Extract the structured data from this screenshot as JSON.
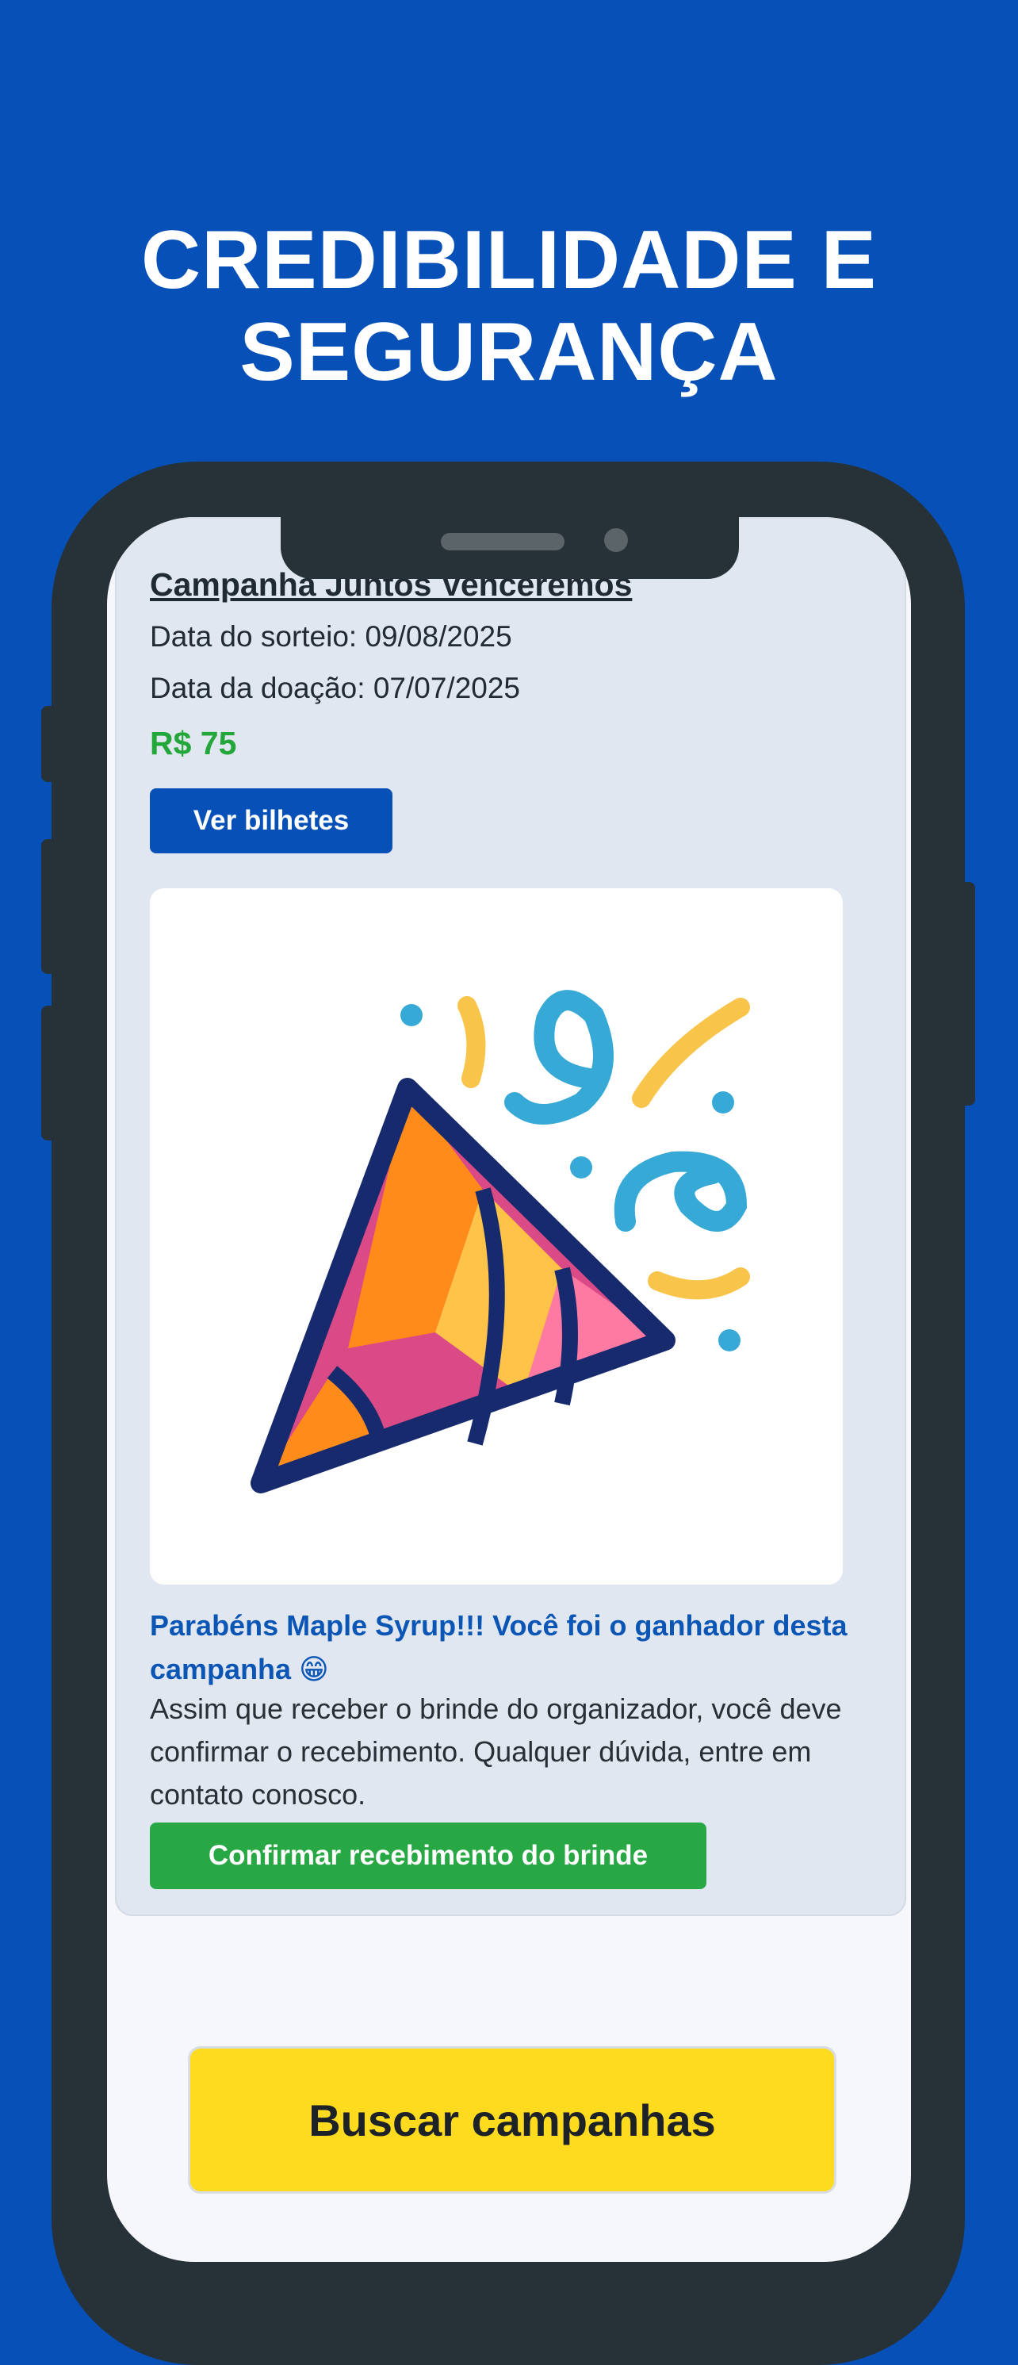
{
  "headline": {
    "line1": "CREDIBILIDADE E",
    "line2": "SEGURANÇA"
  },
  "campaign": {
    "title": "Campanha Juntos Venceremos",
    "draw_date": "Data do sorteio: 09/08/2025",
    "donation_date": "Data da doação: 07/07/2025",
    "price": "R$ 75",
    "view_tickets_label": "Ver bilhetes"
  },
  "illustration": {
    "icon": "party-popper-icon"
  },
  "winner": {
    "congrats": "Parabéns Maple Syrup!!! Você foi o ganhador desta campanha 😁",
    "instructions": "Assim que receber o brinde do organizador, você deve confirmar o recebimento. Qualquer dúvida, entre em contato conosco.",
    "confirm_label": "Confirmar recebimento do brinde"
  },
  "footer": {
    "search_label": "Buscar campanhas"
  },
  "colors": {
    "brand_blue": "#0650b8",
    "success_green": "#27a844",
    "accent_yellow": "#fedb1e",
    "price_green": "#24a73a"
  }
}
